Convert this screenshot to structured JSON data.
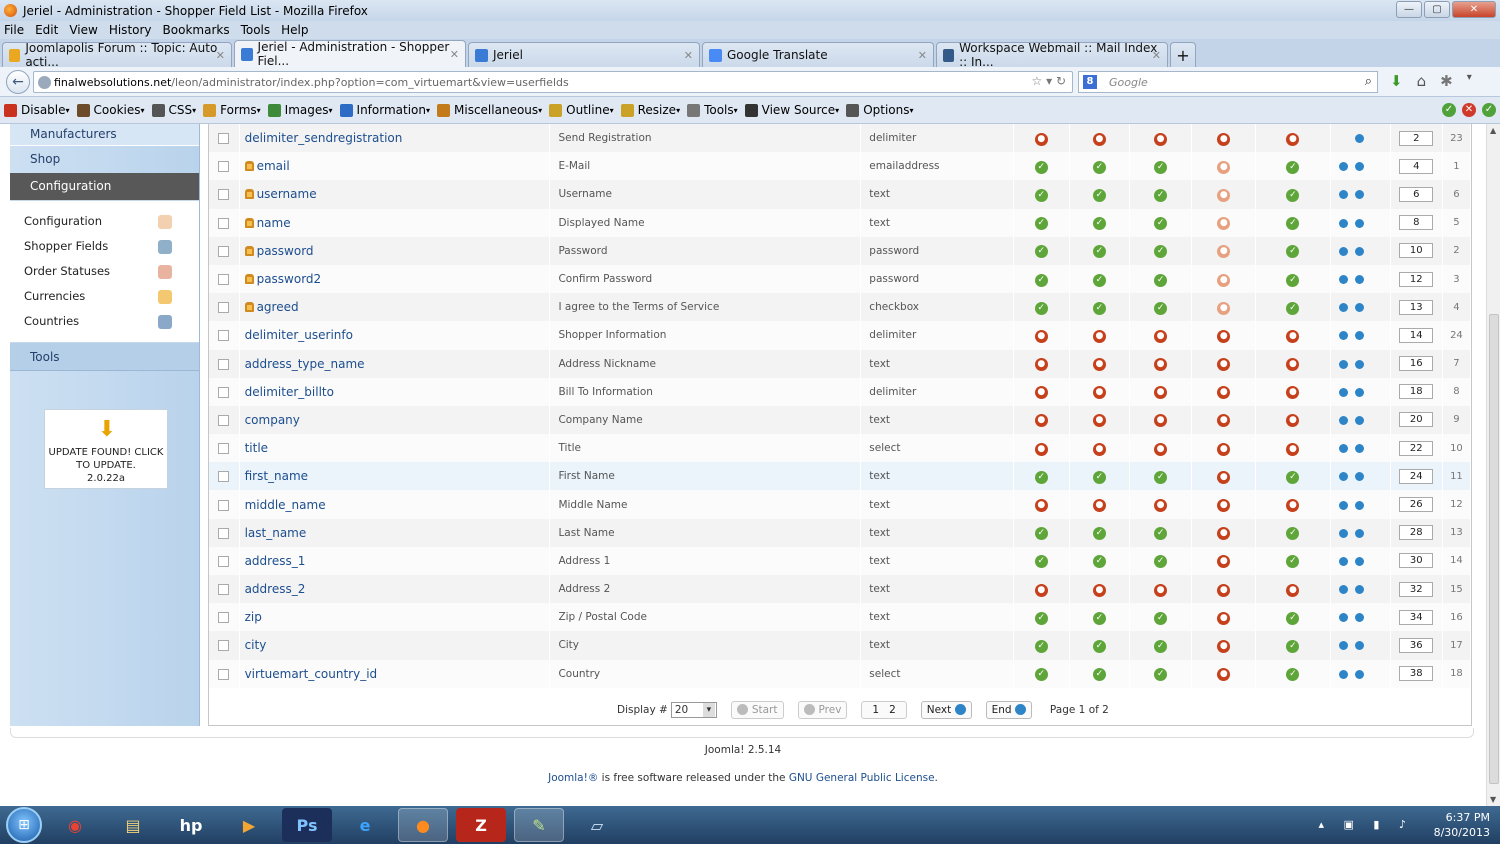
{
  "window": {
    "title": "Jeriel - Administration - Shopper Field List - Mozilla Firefox"
  },
  "menu": [
    "File",
    "Edit",
    "View",
    "History",
    "Bookmarks",
    "Tools",
    "Help"
  ],
  "tabs": [
    {
      "label": "Joomlapolis Forum :: Topic: Auto acti...",
      "color": "#e9a81f"
    },
    {
      "label": "Jeriel - Administration - Shopper Fiel...",
      "color": "#3a7bd5"
    },
    {
      "label": "Jeriel",
      "color": "#3a7bd5"
    },
    {
      "label": "Google Translate",
      "color": "#4a8af4"
    },
    {
      "label": "Workspace Webmail :: Mail Index :: In...",
      "color": "#345a8a"
    }
  ],
  "nav": {
    "url_domain": "finalwebsolutions.net",
    "url_path": "/leon/administrator/index.php?option=com_virtuemart&view=userfields",
    "search_placeholder": "Google"
  },
  "devbar": [
    "Disable",
    "Cookies",
    "CSS",
    "Forms",
    "Images",
    "Information",
    "Miscellaneous",
    "Outline",
    "Resize",
    "Tools",
    "View Source",
    "Options"
  ],
  "sidebar": {
    "top": "Manufacturers",
    "items": [
      "Shop",
      "Configuration"
    ],
    "sub": [
      "Configuration",
      "Shopper Fields",
      "Order Statuses",
      "Currencies",
      "Countries"
    ],
    "tools": "Tools",
    "update": "UPDATE FOUND! CLICK TO UPDATE.",
    "version": "2.0.22a"
  },
  "rows": [
    {
      "name": "delimiter_sendregistration",
      "title": "Send Registration",
      "type": "delimiter",
      "locked": false,
      "s": "nnnnn",
      "up": false,
      "order": "2",
      "id": "23"
    },
    {
      "name": "email",
      "title": "E-Mail",
      "type": "emailaddress",
      "locked": true,
      "s": "yyyly",
      "up": true,
      "order": "4",
      "id": "1"
    },
    {
      "name": "username",
      "title": "Username",
      "type": "text",
      "locked": true,
      "s": "yyyly",
      "up": true,
      "order": "6",
      "id": "6"
    },
    {
      "name": "name",
      "title": "Displayed Name",
      "type": "text",
      "locked": true,
      "s": "yyyly",
      "up": true,
      "order": "8",
      "id": "5"
    },
    {
      "name": "password",
      "title": "Password",
      "type": "password",
      "locked": true,
      "s": "yyyly",
      "up": true,
      "order": "10",
      "id": "2"
    },
    {
      "name": "password2",
      "title": "Confirm Password",
      "type": "password",
      "locked": true,
      "s": "yyyly",
      "up": true,
      "order": "12",
      "id": "3"
    },
    {
      "name": "agreed",
      "title": "I agree to the Terms of Service",
      "type": "checkbox",
      "locked": true,
      "s": "yyyly",
      "up": true,
      "order": "13",
      "id": "4"
    },
    {
      "name": "delimiter_userinfo",
      "title": "Shopper Information",
      "type": "delimiter",
      "locked": false,
      "s": "nnnnn",
      "up": true,
      "order": "14",
      "id": "24"
    },
    {
      "name": "address_type_name",
      "title": "Address Nickname",
      "type": "text",
      "locked": false,
      "s": "nnnnn",
      "up": true,
      "order": "16",
      "id": "7"
    },
    {
      "name": "delimiter_billto",
      "title": "Bill To Information",
      "type": "delimiter",
      "locked": false,
      "s": "nnnnn",
      "up": true,
      "order": "18",
      "id": "8"
    },
    {
      "name": "company",
      "title": "Company Name",
      "type": "text",
      "locked": false,
      "s": "nnnnn",
      "up": true,
      "order": "20",
      "id": "9"
    },
    {
      "name": "title",
      "title": "Title",
      "type": "select",
      "locked": false,
      "s": "nnnnn",
      "up": true,
      "order": "22",
      "id": "10"
    },
    {
      "name": "first_name",
      "title": "First Name",
      "type": "text",
      "locked": false,
      "s": "yyyny",
      "up": true,
      "order": "24",
      "id": "11"
    },
    {
      "name": "middle_name",
      "title": "Middle Name",
      "type": "text",
      "locked": false,
      "s": "nnnnn",
      "up": true,
      "order": "26",
      "id": "12"
    },
    {
      "name": "last_name",
      "title": "Last Name",
      "type": "text",
      "locked": false,
      "s": "yyyny",
      "up": true,
      "order": "28",
      "id": "13"
    },
    {
      "name": "address_1",
      "title": "Address 1",
      "type": "text",
      "locked": false,
      "s": "yyyny",
      "up": true,
      "order": "30",
      "id": "14"
    },
    {
      "name": "address_2",
      "title": "Address 2",
      "type": "text",
      "locked": false,
      "s": "nnnnn",
      "up": true,
      "order": "32",
      "id": "15"
    },
    {
      "name": "zip",
      "title": "Zip / Postal Code",
      "type": "text",
      "locked": false,
      "s": "yyyny",
      "up": true,
      "order": "34",
      "id": "16"
    },
    {
      "name": "city",
      "title": "City",
      "type": "text",
      "locked": false,
      "s": "yyyny",
      "up": true,
      "order": "36",
      "id": "17"
    },
    {
      "name": "virtuemart_country_id",
      "title": "Country",
      "type": "select",
      "locked": false,
      "s": "yyyny",
      "up": true,
      "order": "38",
      "id": "18"
    }
  ],
  "pager": {
    "display_label": "Display #",
    "display_value": "20",
    "start": "Start",
    "prev": "Prev",
    "page1": "1",
    "page2": "2",
    "next": "Next",
    "end": "End",
    "info": "Page 1 of 2"
  },
  "footer": {
    "version": "Joomla! 2.5.14",
    "text_a": "Joomla!®",
    "text_b": " is free software released under the ",
    "license": "GNU General Public License",
    "text_c": "."
  },
  "taskbar": {
    "time": "6:37 PM",
    "date": "8/30/2013"
  }
}
